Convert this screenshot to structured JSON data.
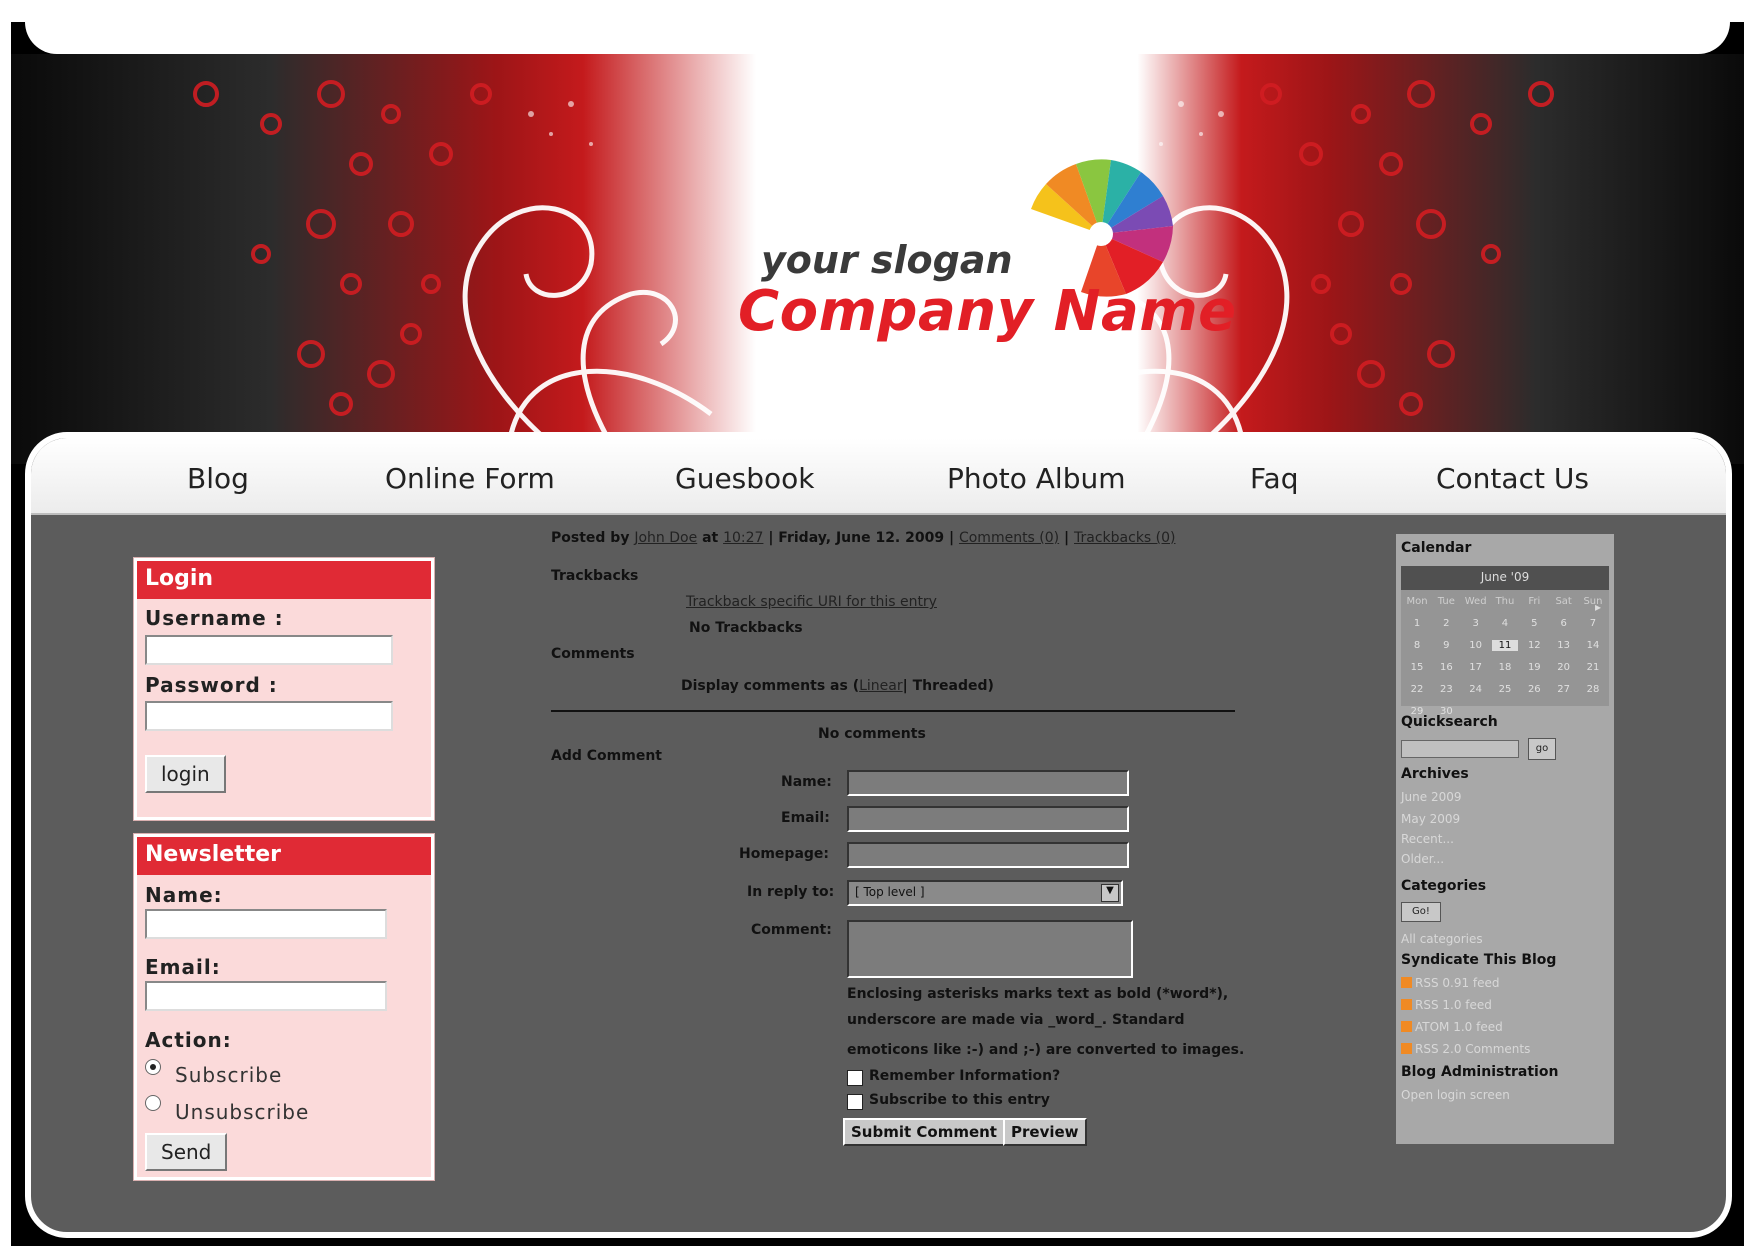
{
  "header": {
    "slogan": "your slogan",
    "company_name": "Company Name"
  },
  "nav": {
    "items": [
      {
        "label": "Blog",
        "name": "nav-blog"
      },
      {
        "label": "Online Form",
        "name": "nav-online-form"
      },
      {
        "label": "Guesbook",
        "name": "nav-guesbook"
      },
      {
        "label": "Photo Album",
        "name": "nav-photo-album"
      },
      {
        "label": "Faq",
        "name": "nav-faq"
      },
      {
        "label": "Contact Us",
        "name": "nav-contact-us"
      }
    ]
  },
  "login": {
    "title": "Login",
    "username_label": "Username :",
    "password_label": "Password :",
    "button": "login"
  },
  "newsletter": {
    "title": "Newsletter",
    "name_label": "Name:",
    "email_label": "Email:",
    "action_label": "Action:",
    "subscribe": "Subscribe",
    "unsubscribe": "Unsubscribe",
    "button": "Send"
  },
  "entry": {
    "posted_by": "Posted by",
    "author": "John Doe",
    "at": "at",
    "time": "10:27",
    "date": "| Friday, June 12. 2009 |",
    "comments_link": "Comments (0)",
    "sep": "|",
    "trackbacks_link": "Trackbacks (0)",
    "trackbacks_heading": "Trackbacks",
    "trackback_uri": "Trackback specific URI for this entry",
    "no_trackbacks": "No Trackbacks",
    "comments_heading": "Comments",
    "display_as": "Display comments as (",
    "linear": "Linear",
    "threaded": "| Threaded)",
    "no_comments": "No comments",
    "add_comment": "Add Comment",
    "name_label": "Name:",
    "email_label": "Email:",
    "homepage_label": "Homepage:",
    "in_reply_to_label": "In reply to:",
    "reply_select_value": "[ Top level ]",
    "comment_label": "Comment:",
    "markup_help_1": "Enclosing asterisks marks text as bold (*word*),",
    "markup_help_2": "underscore are made via _word_. Standard",
    "markup_help_3": "emoticons like :-) and ;-) are converted to images.",
    "remember_info": "Remember Information?",
    "subscribe_entry": "Subscribe to this entry",
    "submit_button": "Submit Comment",
    "preview_button": "Preview"
  },
  "sidebar": {
    "calendar_title": "Calendar",
    "calendar_month": "June '09",
    "calendar_days": [
      "Mon",
      "Tue",
      "Wed",
      "Thu",
      "Fri",
      "Sat",
      "Sun"
    ],
    "calendar_weeks": [
      [
        "1",
        "2",
        "3",
        "4",
        "5",
        "6",
        "7"
      ],
      [
        "8",
        "9",
        "10",
        "11",
        "12",
        "13",
        "14"
      ],
      [
        "15",
        "16",
        "17",
        "18",
        "19",
        "20",
        "21"
      ],
      [
        "22",
        "23",
        "24",
        "25",
        "26",
        "27",
        "28"
      ],
      [
        "29",
        "30",
        "",
        "",
        "",
        "",
        ""
      ]
    ],
    "quicksearch_title": "Quicksearch",
    "go_button": "go",
    "archives_title": "Archives",
    "archives": [
      "June 2009",
      "May 2009",
      "Recent...",
      "Older..."
    ],
    "categories_title": "Categories",
    "categories_button": "Go!",
    "all_categories": "All categories",
    "syndicate_title": "Syndicate This Blog",
    "feeds": [
      "RSS 0.91 feed",
      "RSS 1.0 feed",
      "ATOM 1.0 feed",
      "RSS 2.0 Comments"
    ],
    "admin_title": "Blog Administration",
    "open_login": "Open login screen"
  },
  "colors": {
    "accent_red": "#e02a35",
    "content_bg": "#5c5c5c",
    "sidebar_bg": "#a8a8a8",
    "box_bg": "#fbdada"
  }
}
